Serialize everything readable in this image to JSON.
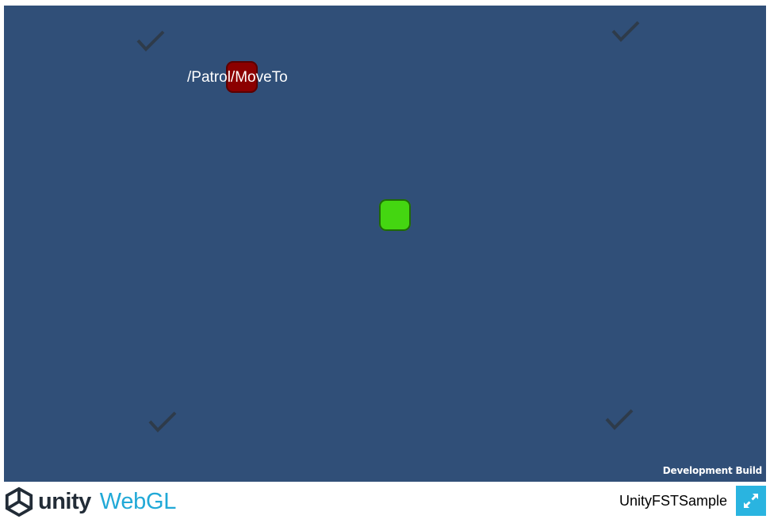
{
  "game": {
    "state_label": "/Patrol/MoveTo",
    "dev_build_label": "Development Build",
    "background_color": "#304f78",
    "enemy_color": "#8b0000",
    "player_color": "#44d611",
    "waypoints": [
      {
        "icon": "checkmark-icon"
      },
      {
        "icon": "checkmark-icon"
      },
      {
        "icon": "checkmark-icon"
      },
      {
        "icon": "checkmark-icon"
      }
    ]
  },
  "footer": {
    "logo_text": "unity",
    "logo_webgl": "WebGL",
    "build_title": "UnityFSTSample",
    "fullscreen_icon": "expand-icon",
    "logo_icon": "unity-logo-icon",
    "webgl_color": "#21a9d7",
    "fullscreen_color": "#2ab4e0"
  }
}
